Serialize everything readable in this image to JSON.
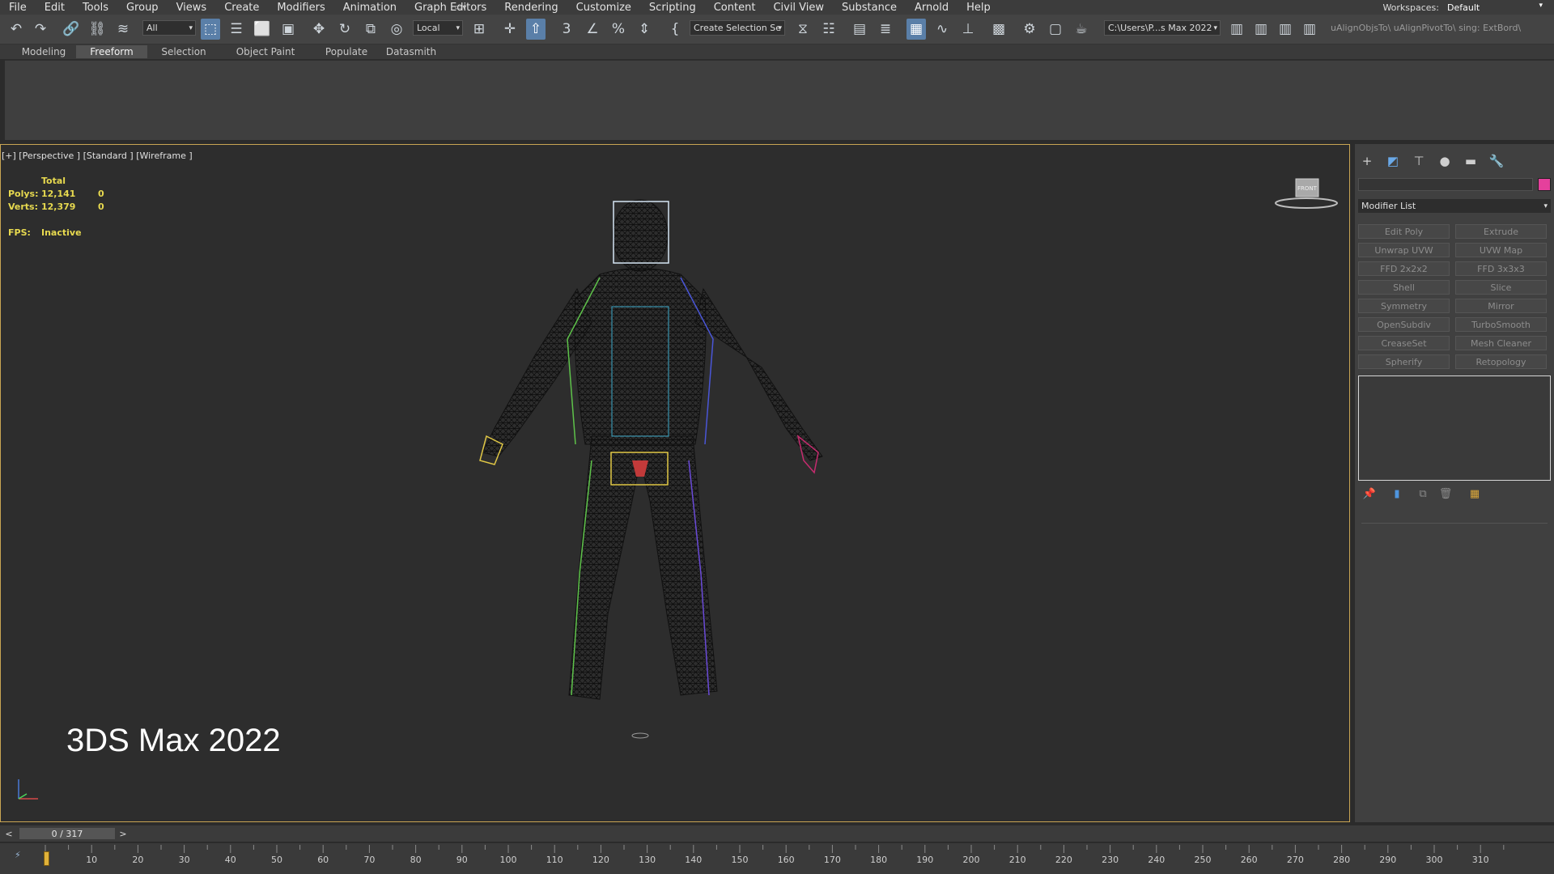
{
  "menu": [
    "File",
    "Edit",
    "Tools",
    "Group",
    "Views",
    "Create",
    "Modifiers",
    "Animation",
    "Graph Editors",
    "Rendering",
    "Customize",
    "Scripting",
    "Content",
    "Civil View",
    "Substance",
    "Arnold",
    "Help"
  ],
  "workspaces": {
    "label": "Workspaces:",
    "value": "Default"
  },
  "toolbar": {
    "filter_value": "All",
    "coord_value": "Local",
    "selection_set_value": "Create Selection Se",
    "path_value": "C:\\Users\\P...s Max 2022",
    "script_text": "uAlignObjsTo\\ uAlignPivotTo\\ sing: ExtBord\\"
  },
  "ribbon": {
    "tabs": [
      "Modeling",
      "Freeform",
      "Selection",
      "Object Paint",
      "Populate",
      "Datasmith"
    ],
    "active_tab": "Freeform"
  },
  "viewport": {
    "label": "[+] [Perspective ] [Standard ] [Wireframe ]",
    "stats": {
      "total_label": "Total",
      "polys_label": "Polys:",
      "polys_value": "12,141",
      "polys_sel": "0",
      "verts_label": "Verts:",
      "verts_value": "12,379",
      "verts_sel": "0",
      "fps_label": "FPS:",
      "fps_value": "Inactive"
    },
    "watermark": "3DS Max 2022",
    "viewcube_label": "FRONT"
  },
  "command_panel": {
    "modifier_list_label": "Modifier List",
    "swatch_color": "#e5409c",
    "modifier_buttons": [
      "Edit Poly",
      "Extrude",
      "Unwrap UVW",
      "UVW Map",
      "FFD 2x2x2",
      "FFD 3x3x3",
      "Shell",
      "Slice",
      "Symmetry",
      "Mirror",
      "OpenSubdiv",
      "TurboSmooth",
      "CreaseSet",
      "Mesh Cleaner",
      "Spherify",
      "Retopology"
    ]
  },
  "timeslider": {
    "position": "0 / 317",
    "prev": "<",
    "next": ">"
  },
  "trackbar": {
    "ticks": [
      "10",
      "20",
      "30",
      "40",
      "50",
      "60",
      "70",
      "80",
      "90",
      "100",
      "110",
      "120",
      "130",
      "140",
      "150",
      "160",
      "170",
      "180",
      "190",
      "200",
      "210",
      "220",
      "230",
      "240",
      "250",
      "260",
      "270",
      "280",
      "290",
      "300",
      "310"
    ]
  },
  "colors": {
    "accent": "#5a7fa8",
    "viewport_border": "#c9a553",
    "stats_text": "#e7d94f"
  }
}
